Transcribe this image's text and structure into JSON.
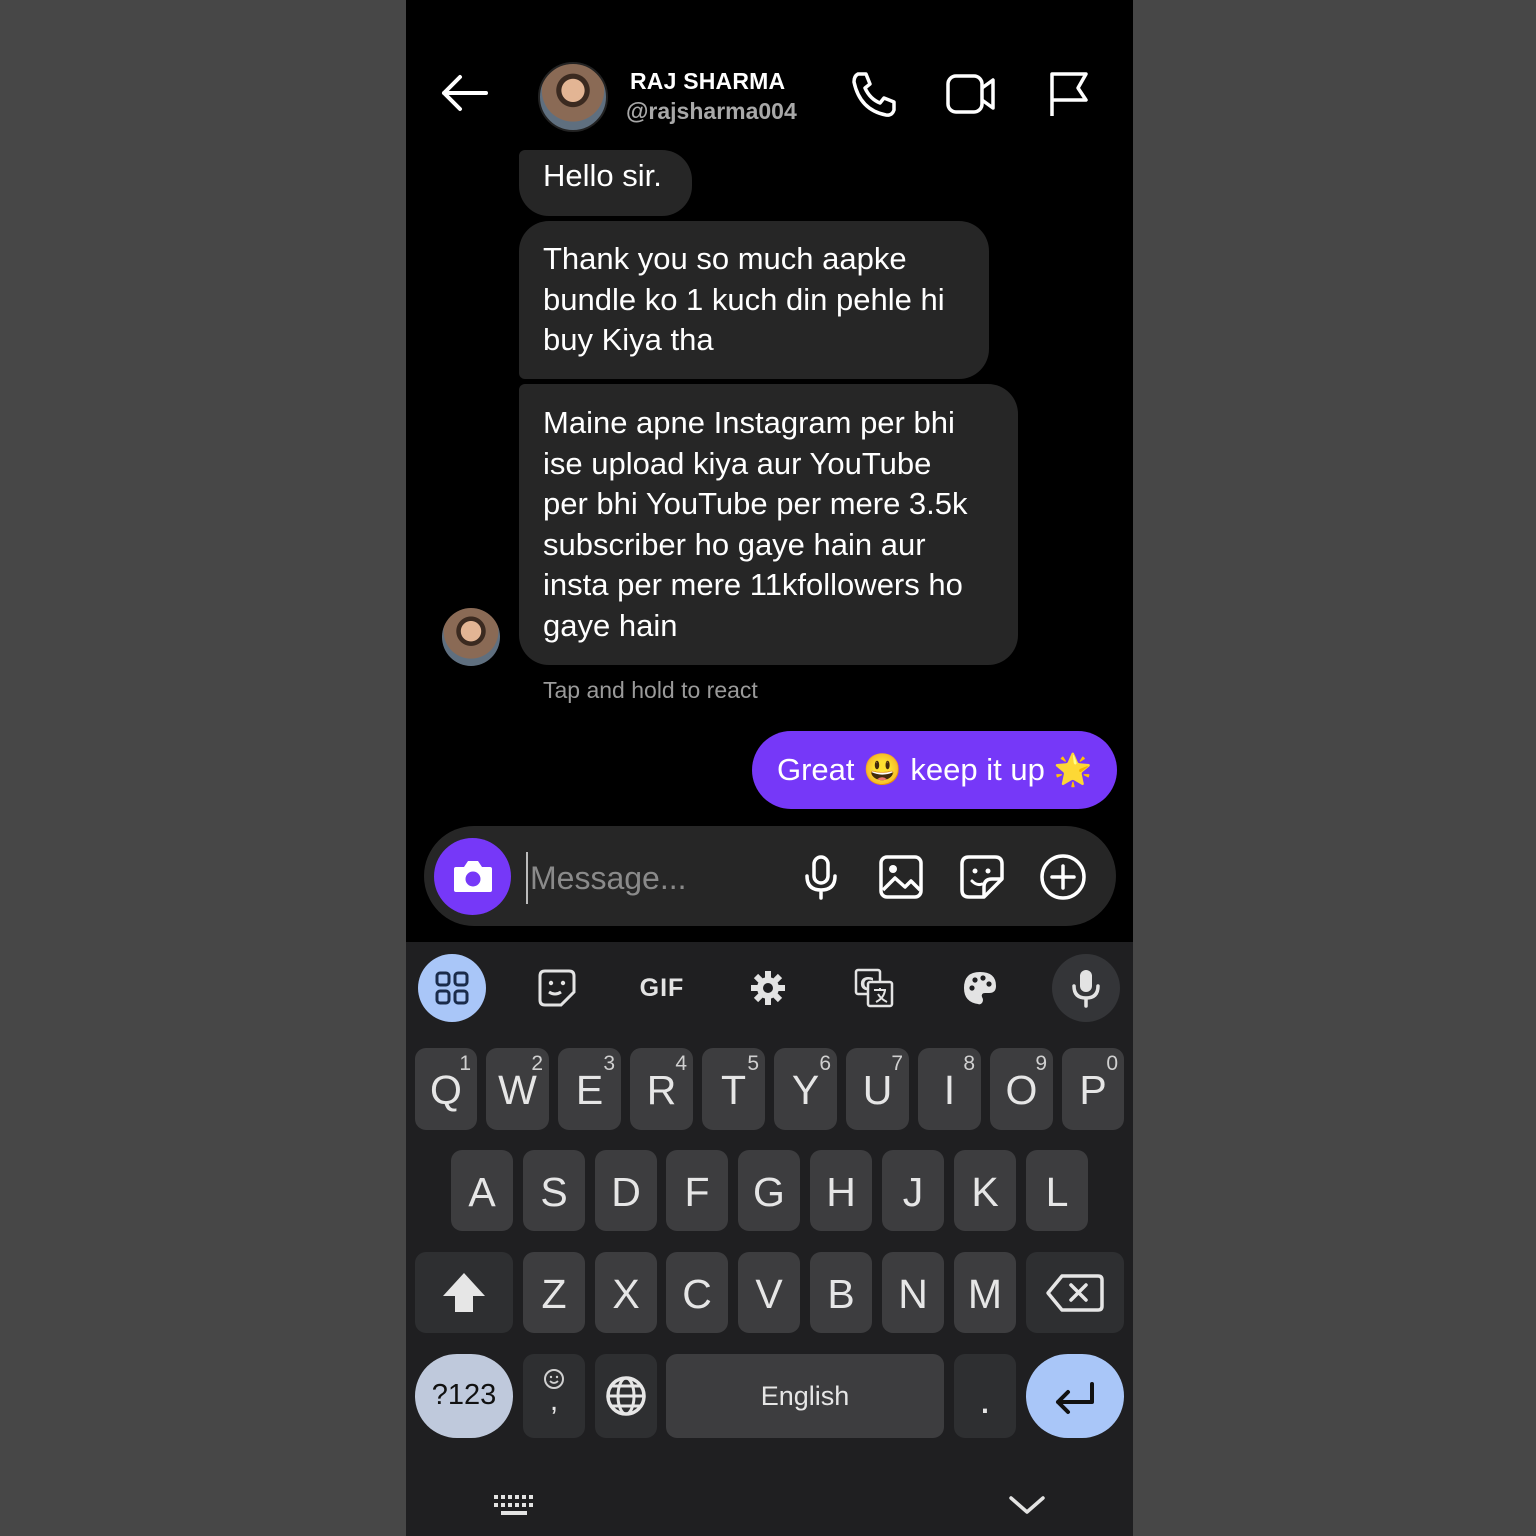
{
  "header": {
    "name": "RAJ SHARMA",
    "handle": "@rajsharma004"
  },
  "messages": {
    "received": [
      {
        "lines": [
          "Hello sir."
        ]
      },
      {
        "lines": [
          "Thank you so much aapke",
          "bundle ko 1 kuch din pehle hi",
          "buy Kiya tha"
        ]
      },
      {
        "lines": [
          "Maine apne Instagram per bhi",
          "ise upload kiya aur YouTube",
          "per bhi YouTube per mere 3.5k",
          "subscriber ho gaye hain aur",
          "insta per mere 11kfollowers ho",
          "gaye hain"
        ]
      }
    ],
    "react_hint": "Tap and hold to react",
    "sent": {
      "text_1": "Great",
      "emoji_1": "😃",
      "text_2": "keep it up",
      "emoji_2": "🌟"
    }
  },
  "composer": {
    "placeholder": "Message..."
  },
  "keyboard": {
    "gif_label": "GIF",
    "row1": [
      {
        "k": "Q",
        "n": "1"
      },
      {
        "k": "W",
        "n": "2"
      },
      {
        "k": "E",
        "n": "3"
      },
      {
        "k": "R",
        "n": "4"
      },
      {
        "k": "T",
        "n": "5"
      },
      {
        "k": "Y",
        "n": "6"
      },
      {
        "k": "U",
        "n": "7"
      },
      {
        "k": "I",
        "n": "8"
      },
      {
        "k": "O",
        "n": "9"
      },
      {
        "k": "P",
        "n": "0"
      }
    ],
    "row2": [
      "A",
      "S",
      "D",
      "F",
      "G",
      "H",
      "J",
      "K",
      "L"
    ],
    "row3": [
      "Z",
      "X",
      "C",
      "V",
      "B",
      "N",
      "M"
    ],
    "symbols_label": "?123",
    "comma_label": ",",
    "space_label": "English",
    "period_label": "."
  },
  "colors": {
    "accent": "#7638f8",
    "bubble": "#262626",
    "keyboard_bg": "#1f1f21",
    "key": "#3d3d3f",
    "active_tool": "#a9c6f8"
  },
  "icons": {
    "back": "arrow-left-icon",
    "call": "phone-icon",
    "video": "video-camera-icon",
    "report": "flag-icon",
    "camera": "camera-icon",
    "voice": "microphone-icon",
    "gallery": "image-icon",
    "sticker": "sticker-icon",
    "more": "plus-circle-icon"
  }
}
